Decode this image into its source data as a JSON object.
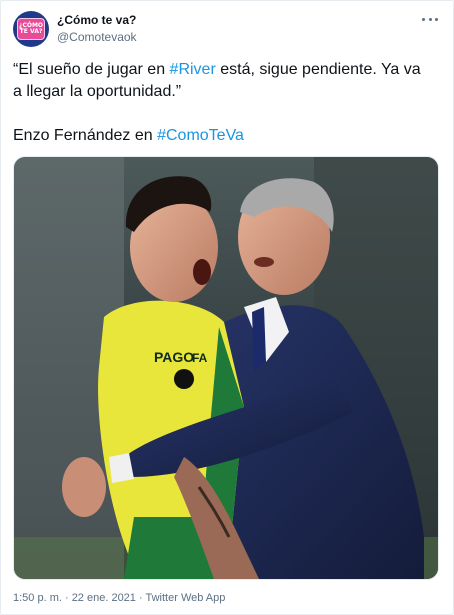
{
  "author": {
    "display_name": "¿Cómo te va?",
    "handle": "@Comotevaok",
    "avatar_text": "¿CÓMO TE VA?"
  },
  "tweet": {
    "text_line1": "“El sueño de jugar en ",
    "hashtag1": "#River",
    "text_line1_rest": " está, sigue pendiente. Ya va a llegar la oportunidad.”",
    "text_line2": "Enzo Fernández en ",
    "hashtag2": "#ComoTeVa"
  },
  "photo": {
    "jersey_sponsor": "PAGO",
    "jersey_sponsor_suffix": "FA"
  },
  "meta": {
    "timestamp": "1:50 p. m. · 22 ene. 2021 · Twitter Web App"
  },
  "colors": {
    "link": "#1b95e0",
    "secondary_text": "#5b7083",
    "jersey_yellow": "#e8e63a",
    "jersey_green": "#1f7a3a",
    "suit_navy": "#1e2a52"
  }
}
